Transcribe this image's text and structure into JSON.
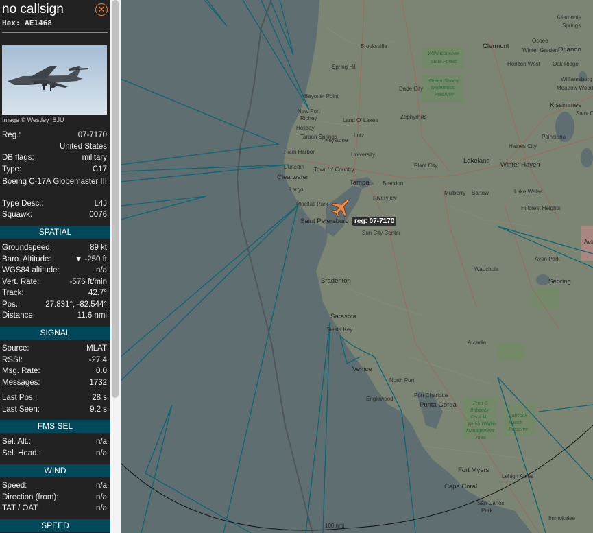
{
  "header": {
    "callsign": "no callsign",
    "hex_label": "Hex:",
    "hex": "AE1468",
    "close_glyph": "✕"
  },
  "photo": {
    "credit": "Image © Westley_SJU"
  },
  "details": {
    "reg": {
      "label": "Reg.:",
      "value": "07-7170"
    },
    "country": "United States",
    "db_flags": {
      "label": "DB flags:",
      "value": "military"
    },
    "type": {
      "label": "Type:",
      "value": "C17"
    },
    "type_full": "Boeing C-17A Globemaster III",
    "type_desc": {
      "label": "Type Desc.:",
      "value": "L4J"
    },
    "squawk": {
      "label": "Squawk:",
      "value": "0076"
    }
  },
  "sections": {
    "spatial": "SPATIAL",
    "signal": "SIGNAL",
    "fms_sel": "FMS SEL",
    "wind": "WIND",
    "speed": "SPEED"
  },
  "spatial": {
    "groundspeed": {
      "label": "Groundspeed:",
      "value": "89 kt"
    },
    "baro_alt": {
      "label": "Baro. Altitude:",
      "value": "▼ -250 ft"
    },
    "wgs84_alt": {
      "label": "WGS84 altitude:",
      "value": "n/a"
    },
    "vert_rate": {
      "label": "Vert. Rate:",
      "value": "-576 ft/min"
    },
    "track": {
      "label": "Track:",
      "value": "42.7°"
    },
    "pos": {
      "label": "Pos.:",
      "value": "27.831°, -82.544°"
    },
    "distance": {
      "label": "Distance:",
      "value": "11.6 nmi"
    }
  },
  "signal": {
    "source": {
      "label": "Source:",
      "value": "MLAT"
    },
    "rssi": {
      "label": "RSSI:",
      "value": "-27.4"
    },
    "msg_rate": {
      "label": "Msg. Rate:",
      "value": "0.0"
    },
    "messages": {
      "label": "Messages:",
      "value": "1732"
    },
    "last_pos": {
      "label": "Last Pos.:",
      "value": "28 s"
    },
    "last_seen": {
      "label": "Last Seen:",
      "value": "9.2 s"
    }
  },
  "fms": {
    "sel_alt": {
      "label": "Sel. Alt.:",
      "value": "n/a"
    },
    "sel_head": {
      "label": "Sel. Head.:",
      "value": "n/a"
    }
  },
  "wind": {
    "speed": {
      "label": "Speed:",
      "value": "n/a"
    },
    "direction": {
      "label": "Direction (from):",
      "value": "n/a"
    },
    "tat_oat": {
      "label": "TAT / OAT:",
      "value": "n/a"
    }
  },
  "map": {
    "plane_label": "reg: 07-7170",
    "scale": "100 nmi",
    "towns": [
      "Brooksville",
      "Spring Hill",
      "Withlacoochee State Forest",
      "Clermont",
      "Ocoee",
      "Orlando",
      "Altamonte Springs",
      "Winter Garden",
      "Horizon West",
      "Oak Ridge",
      "Dade City",
      "Green Swamp Wilderness Preserve",
      "Williamsburg",
      "Meadow Woods",
      "Kissimmee",
      "Bayonet Point",
      "New Port Richey",
      "Holiday",
      "Land O' Lakes",
      "Zephyrhills",
      "Tarpon Springs",
      "Keystone",
      "Lutz",
      "Palm Harbor",
      "University",
      "Poinciana",
      "Haines City",
      "Dunedin",
      "Town 'n' Country",
      "Plant City",
      "Lakeland",
      "Winter Haven",
      "Clearwater",
      "Tampa",
      "Brandon",
      "Largo",
      "Riverview",
      "Mulberry",
      "Bartow",
      "Lake Wales",
      "Pinellas Park",
      "Hillcrest Heights",
      "Saint Petersburg",
      "Sun City Center",
      "Avon Park",
      "Wauchula",
      "Bradenton",
      "Sebring",
      "Sarasota",
      "Siesta Key",
      "Arcadia",
      "Venice",
      "North Port",
      "Englewood",
      "Port Charlotte",
      "Punta Gorda",
      "Fred C. Babcock-Cecil M. Webb Wildlife Management Area",
      "Babcock Ranch Preserve",
      "Fort Myers",
      "Lehigh Acres",
      "Cape Coral",
      "San Carlos Park",
      "Immokalee",
      "Avon Park Air Force Range",
      "Saint Cloud"
    ]
  }
}
